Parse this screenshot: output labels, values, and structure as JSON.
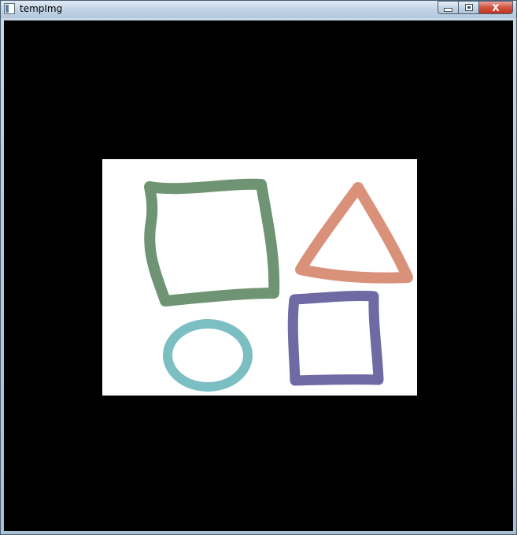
{
  "window": {
    "title": "tempImg",
    "controls": {
      "close_glyph": "X"
    }
  },
  "image": {
    "background": "#000000",
    "canvas_color": "#ffffff",
    "shapes": [
      {
        "name": "green-square",
        "color": "#6f9473"
      },
      {
        "name": "orange-triangle",
        "color": "#d9917a"
      },
      {
        "name": "teal-circle",
        "color": "#7bbfc2"
      },
      {
        "name": "purple-square",
        "color": "#6f6aa3"
      }
    ]
  }
}
